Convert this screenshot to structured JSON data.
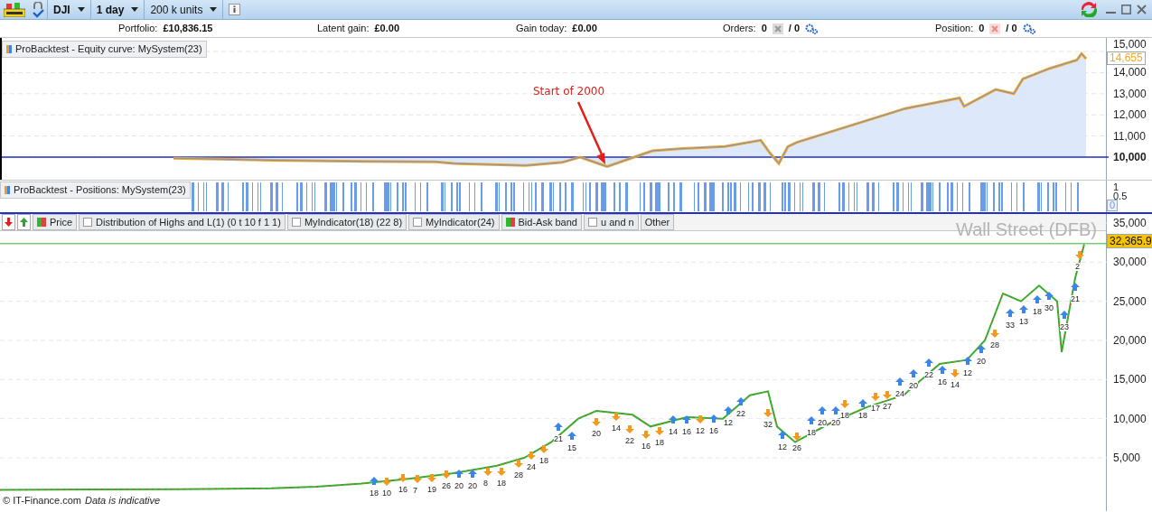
{
  "toolbar": {
    "instrument": "DJI",
    "period": "1 day",
    "units": "200 k units"
  },
  "account": [
    {
      "label": "Portfolio:",
      "value": "£10,836.15"
    },
    {
      "label": "Latent gain:",
      "value": "£0.00"
    },
    {
      "label": "Gain today:",
      "value": "£0.00"
    }
  ],
  "orders": {
    "label": "Orders:",
    "count": "0",
    "separator": "/ 0"
  },
  "position": {
    "label": "Position:",
    "count": "0",
    "separator": "/ 0"
  },
  "equity_panel": {
    "title": "ProBacktest - Equity curve: MySystem(23)",
    "current_value": "14,655",
    "annotation": "Start of 2000",
    "axis_labels": [
      "15,000",
      "14,000",
      "13,000",
      "12,000",
      "11,000",
      "10,000"
    ]
  },
  "positions_panel": {
    "title": "ProBacktest - Positions: MySystem(23)",
    "axis_labels": [
      "1",
      "0.5"
    ],
    "current_value": "0"
  },
  "legend": [
    {
      "kind": "down"
    },
    {
      "kind": "up"
    },
    {
      "kind": "swatch",
      "label": "Price"
    },
    {
      "kind": "checkbox",
      "label": "Distribution of Highs and L(1) (0 t 10 f 1 1)",
      "checked": false
    },
    {
      "kind": "checkbox",
      "label": "MyIndicator(18) (22 8)",
      "checked": false
    },
    {
      "kind": "checkbox",
      "label": "MyIndicator(24)",
      "checked": false
    },
    {
      "kind": "swatch",
      "label": "Bid-Ask band"
    },
    {
      "kind": "checkbox",
      "label": "u and n",
      "checked": false
    },
    {
      "kind": "plain",
      "label": "Other"
    }
  ],
  "price_panel": {
    "instrument_name": "Wall Street (DFB)",
    "current_value": "32,365.9",
    "copyright": "© IT-Finance.com",
    "disclaimer": "Data is indicative",
    "axis_labels": [
      "35,000",
      "30,000",
      "25,000",
      "20,000",
      "15,000",
      "10,000",
      "5,000"
    ],
    "trades": [
      {
        "label": "18",
        "kind": "up"
      },
      {
        "label": "10",
        "kind": "down"
      },
      {
        "label": "16",
        "kind": "down"
      },
      {
        "label": "7",
        "kind": "down"
      },
      {
        "label": "19",
        "kind": "down"
      },
      {
        "label": "26",
        "kind": "down"
      },
      {
        "label": "20",
        "kind": "up"
      },
      {
        "label": "20",
        "kind": "up"
      },
      {
        "label": "8",
        "kind": "down"
      },
      {
        "label": "18",
        "kind": "down"
      },
      {
        "label": "28",
        "kind": "down"
      },
      {
        "label": "24",
        "kind": "down"
      },
      {
        "label": "18",
        "kind": "down"
      },
      {
        "label": "21",
        "kind": "up"
      },
      {
        "label": "15",
        "kind": "up"
      },
      {
        "label": "20",
        "kind": "down"
      },
      {
        "label": "14",
        "kind": "down"
      },
      {
        "label": "22",
        "kind": "down"
      },
      {
        "label": "16",
        "kind": "down"
      },
      {
        "label": "18",
        "kind": "down"
      },
      {
        "label": "14",
        "kind": "up"
      },
      {
        "label": "16",
        "kind": "up"
      },
      {
        "label": "12",
        "kind": "down"
      },
      {
        "label": "16",
        "kind": "up"
      },
      {
        "label": "12",
        "kind": "up"
      },
      {
        "label": "22",
        "kind": "up"
      },
      {
        "label": "32",
        "kind": "down"
      },
      {
        "label": "12",
        "kind": "up"
      },
      {
        "label": "26",
        "kind": "down"
      },
      {
        "label": "18",
        "kind": "up"
      },
      {
        "label": "20",
        "kind": "up"
      },
      {
        "label": "20",
        "kind": "up"
      },
      {
        "label": "18",
        "kind": "down"
      },
      {
        "label": "18",
        "kind": "up"
      },
      {
        "label": "17",
        "kind": "down"
      },
      {
        "label": "27",
        "kind": "down"
      },
      {
        "label": "24",
        "kind": "up"
      },
      {
        "label": "20",
        "kind": "up"
      },
      {
        "label": "22",
        "kind": "up"
      },
      {
        "label": "16",
        "kind": "up"
      },
      {
        "label": "14",
        "kind": "down"
      },
      {
        "label": "12",
        "kind": "up"
      },
      {
        "label": "20",
        "kind": "up"
      },
      {
        "label": "28",
        "kind": "down"
      },
      {
        "label": "33",
        "kind": "up"
      },
      {
        "label": "13",
        "kind": "up"
      },
      {
        "label": "18",
        "kind": "up"
      },
      {
        "label": "30",
        "kind": "up"
      },
      {
        "label": "23",
        "kind": "up"
      },
      {
        "label": "21",
        "kind": "up"
      },
      {
        "label": "2",
        "kind": "down"
      }
    ]
  }
}
